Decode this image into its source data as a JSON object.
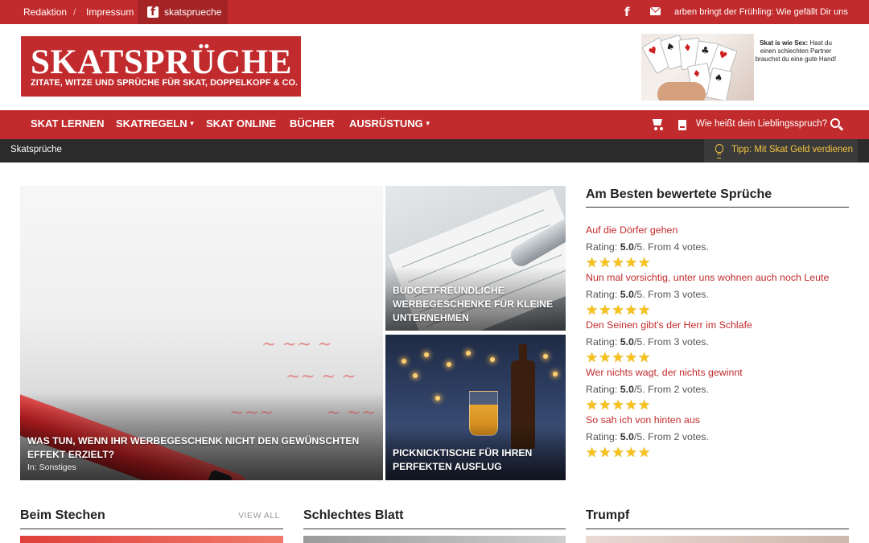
{
  "topbar": {
    "links": [
      "Redaktion",
      "/",
      "Impressum"
    ],
    "facebook_label": "skatsprueche",
    "ticker": "arben bringt der Frühling: Wie gefällt Dir uns"
  },
  "logo": {
    "title": "SKATSPRÜCHE",
    "subtitle": "ZITATE, WITZE UND SPRÜCHE FÜR SKAT, DOPPELKOPF & CO."
  },
  "header_ad": {
    "text_bold": "Skat is wie Sex:",
    "text": "Hast du einen schlechten Partner brauchst du eine gute Hand!"
  },
  "nav": {
    "items": [
      {
        "label": "SKAT LERNEN",
        "dropdown": false
      },
      {
        "label": "SKATREGELN",
        "dropdown": true
      },
      {
        "label": "SKAT ONLINE",
        "dropdown": false
      },
      {
        "label": "BÜCHER",
        "dropdown": false
      },
      {
        "label": "AUSRÜSTUNG",
        "dropdown": true
      }
    ],
    "favorite_prompt": "Wie heißt dein Lieblingsspruch?"
  },
  "breadcrumb": {
    "current": "Skatsprüche",
    "tip": "Tipp: Mit Skat Geld verdienen"
  },
  "featured": [
    {
      "title": "WAS TUN, WENN IHR WERBEGESCHENK NICHT DEN GEWÜNSCHTEN EFFEKT ERZIELT?",
      "category_prefix": "In:",
      "category": "Sonstiges"
    },
    {
      "title": "BUDGETFREUNDLICHE WERBEGESCHENKE FÜR KLEINE UNTERNEHMEN"
    },
    {
      "title": "PICKNICKTISCHE FÜR IHREN PERFEKTEN AUSFLUG"
    }
  ],
  "sidebar": {
    "title": "Am Besten bewertete Sprüche",
    "entries": [
      {
        "title": "Auf die Dörfer gehen",
        "rating_prefix": "Rating:",
        "score": "5.0",
        "suffix": "/5. From 4 votes.",
        "stars": 5
      },
      {
        "title": "Nun mal vorsichtig, unter uns wohnen auch noch Leute",
        "rating_prefix": "Rating:",
        "score": "5.0",
        "suffix": "/5. From 3 votes.",
        "stars": 5
      },
      {
        "title": "Den Seinen gibt's der Herr im Schlafe",
        "rating_prefix": "Rating:",
        "score": "5.0",
        "suffix": "/5. From 3 votes.",
        "stars": 5
      },
      {
        "title": "Wer nichts wagt, der nichts gewinnt",
        "rating_prefix": "Rating:",
        "score": "5.0",
        "suffix": "/5. From 2 votes.",
        "stars": 5
      },
      {
        "title": "So sah ich von hinten aus",
        "rating_prefix": "Rating:",
        "score": "5.0",
        "suffix": "/5. From 2 votes.",
        "stars": 5
      }
    ]
  },
  "sections": [
    {
      "title": "Beim Stechen",
      "more": "VIEW ALL"
    },
    {
      "title": "Schlechtes Blatt"
    },
    {
      "title": "Trumpf"
    }
  ],
  "colors": {
    "brand": "#c22b2d",
    "dark_bar": "#2b2b2b",
    "tip": "#f5c542",
    "star": "#f6c21b"
  }
}
